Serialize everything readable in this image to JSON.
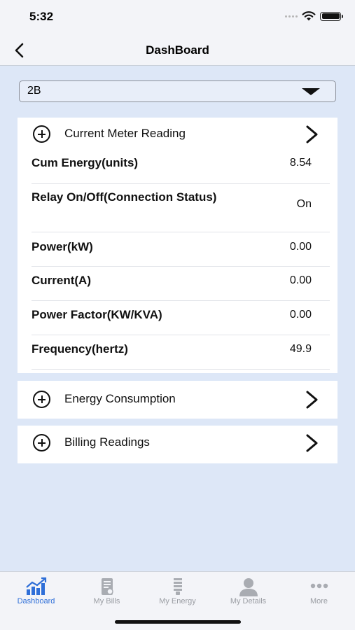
{
  "status_bar": {
    "time": "5:32"
  },
  "nav": {
    "title": "DashBoard"
  },
  "meter_select": {
    "value": "2B"
  },
  "sections": {
    "current_meter_reading": {
      "title": "Current Meter Reading",
      "rows": [
        {
          "label": "Cum Energy(units)",
          "value": "8.54"
        },
        {
          "label": "Relay On/Off(Connection Status)",
          "value": "On"
        },
        {
          "label": "Power(kW)",
          "value": "0.00"
        },
        {
          "label": "Current(A)",
          "value": "0.00"
        },
        {
          "label": "Power Factor(KW/KVA)",
          "value": "0.00"
        },
        {
          "label": "Frequency(hertz)",
          "value": "49.9"
        }
      ]
    },
    "energy_consumption": {
      "title": "Energy Consumption"
    },
    "billing_readings": {
      "title": "Billing Readings"
    }
  },
  "tabs": [
    {
      "label": "Dashboard",
      "icon": "dashboard-chart-icon",
      "active": true
    },
    {
      "label": "My Bills",
      "icon": "bill-icon",
      "active": false
    },
    {
      "label": "My Energy",
      "icon": "bulb-icon",
      "active": false
    },
    {
      "label": "My Details",
      "icon": "person-icon",
      "active": false
    },
    {
      "label": "More",
      "icon": "more-dots-icon",
      "active": false
    }
  ],
  "colors": {
    "accent": "#2f6fd8",
    "background": "#dde7f7",
    "inactive_tab": "#9a9da3"
  }
}
